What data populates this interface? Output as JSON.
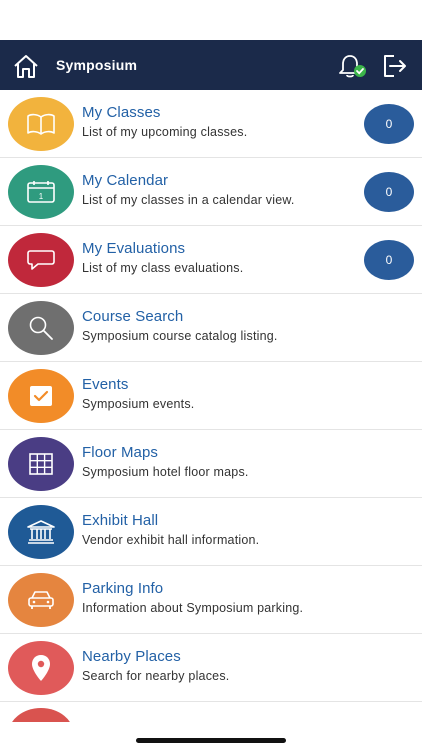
{
  "header": {
    "title": "Symposium",
    "home_icon": "home-icon",
    "notification_icon": "bell-icon",
    "notification_status": "check-badge",
    "logout_icon": "logout-icon"
  },
  "menu": [
    {
      "title": "My Classes",
      "description": "List of my upcoming classes.",
      "icon": "book-icon",
      "color": "#f2b33d",
      "count": "0"
    },
    {
      "title": "My Calendar",
      "description": "List of my classes in a calendar view.",
      "icon": "calendar-icon",
      "color": "#2f9b7f",
      "count": "0",
      "icon_text": "1"
    },
    {
      "title": "My Evaluations",
      "description": "List of my class evaluations.",
      "icon": "speech-bubble-icon",
      "color": "#c0283b",
      "count": "0"
    },
    {
      "title": "Course Search",
      "description": "Symposium course catalog listing.",
      "icon": "magnifier-icon",
      "color": "#6f6f6f"
    },
    {
      "title": "Events",
      "description": "Symposium events.",
      "icon": "checkbox-icon",
      "color": "#f28c28"
    },
    {
      "title": "Floor Maps",
      "description": "Symposium hotel floor maps.",
      "icon": "grid-icon",
      "color": "#4a3d84"
    },
    {
      "title": "Exhibit Hall",
      "description": "Vendor exhibit hall information.",
      "icon": "building-icon",
      "color": "#1f5a96"
    },
    {
      "title": "Parking Info",
      "description": "Information about Symposium parking.",
      "icon": "car-icon",
      "color": "#e5853f"
    },
    {
      "title": "Nearby Places",
      "description": "Search for nearby places.",
      "icon": "location-pin-icon",
      "color": "#e05a5a"
    }
  ],
  "partial_item_color": "#d9534f",
  "colors": {
    "header_bg": "#1b2a4a",
    "title_blue": "#2361a6",
    "badge_blue": "#2a5c9b",
    "check_green": "#3cb54a"
  }
}
